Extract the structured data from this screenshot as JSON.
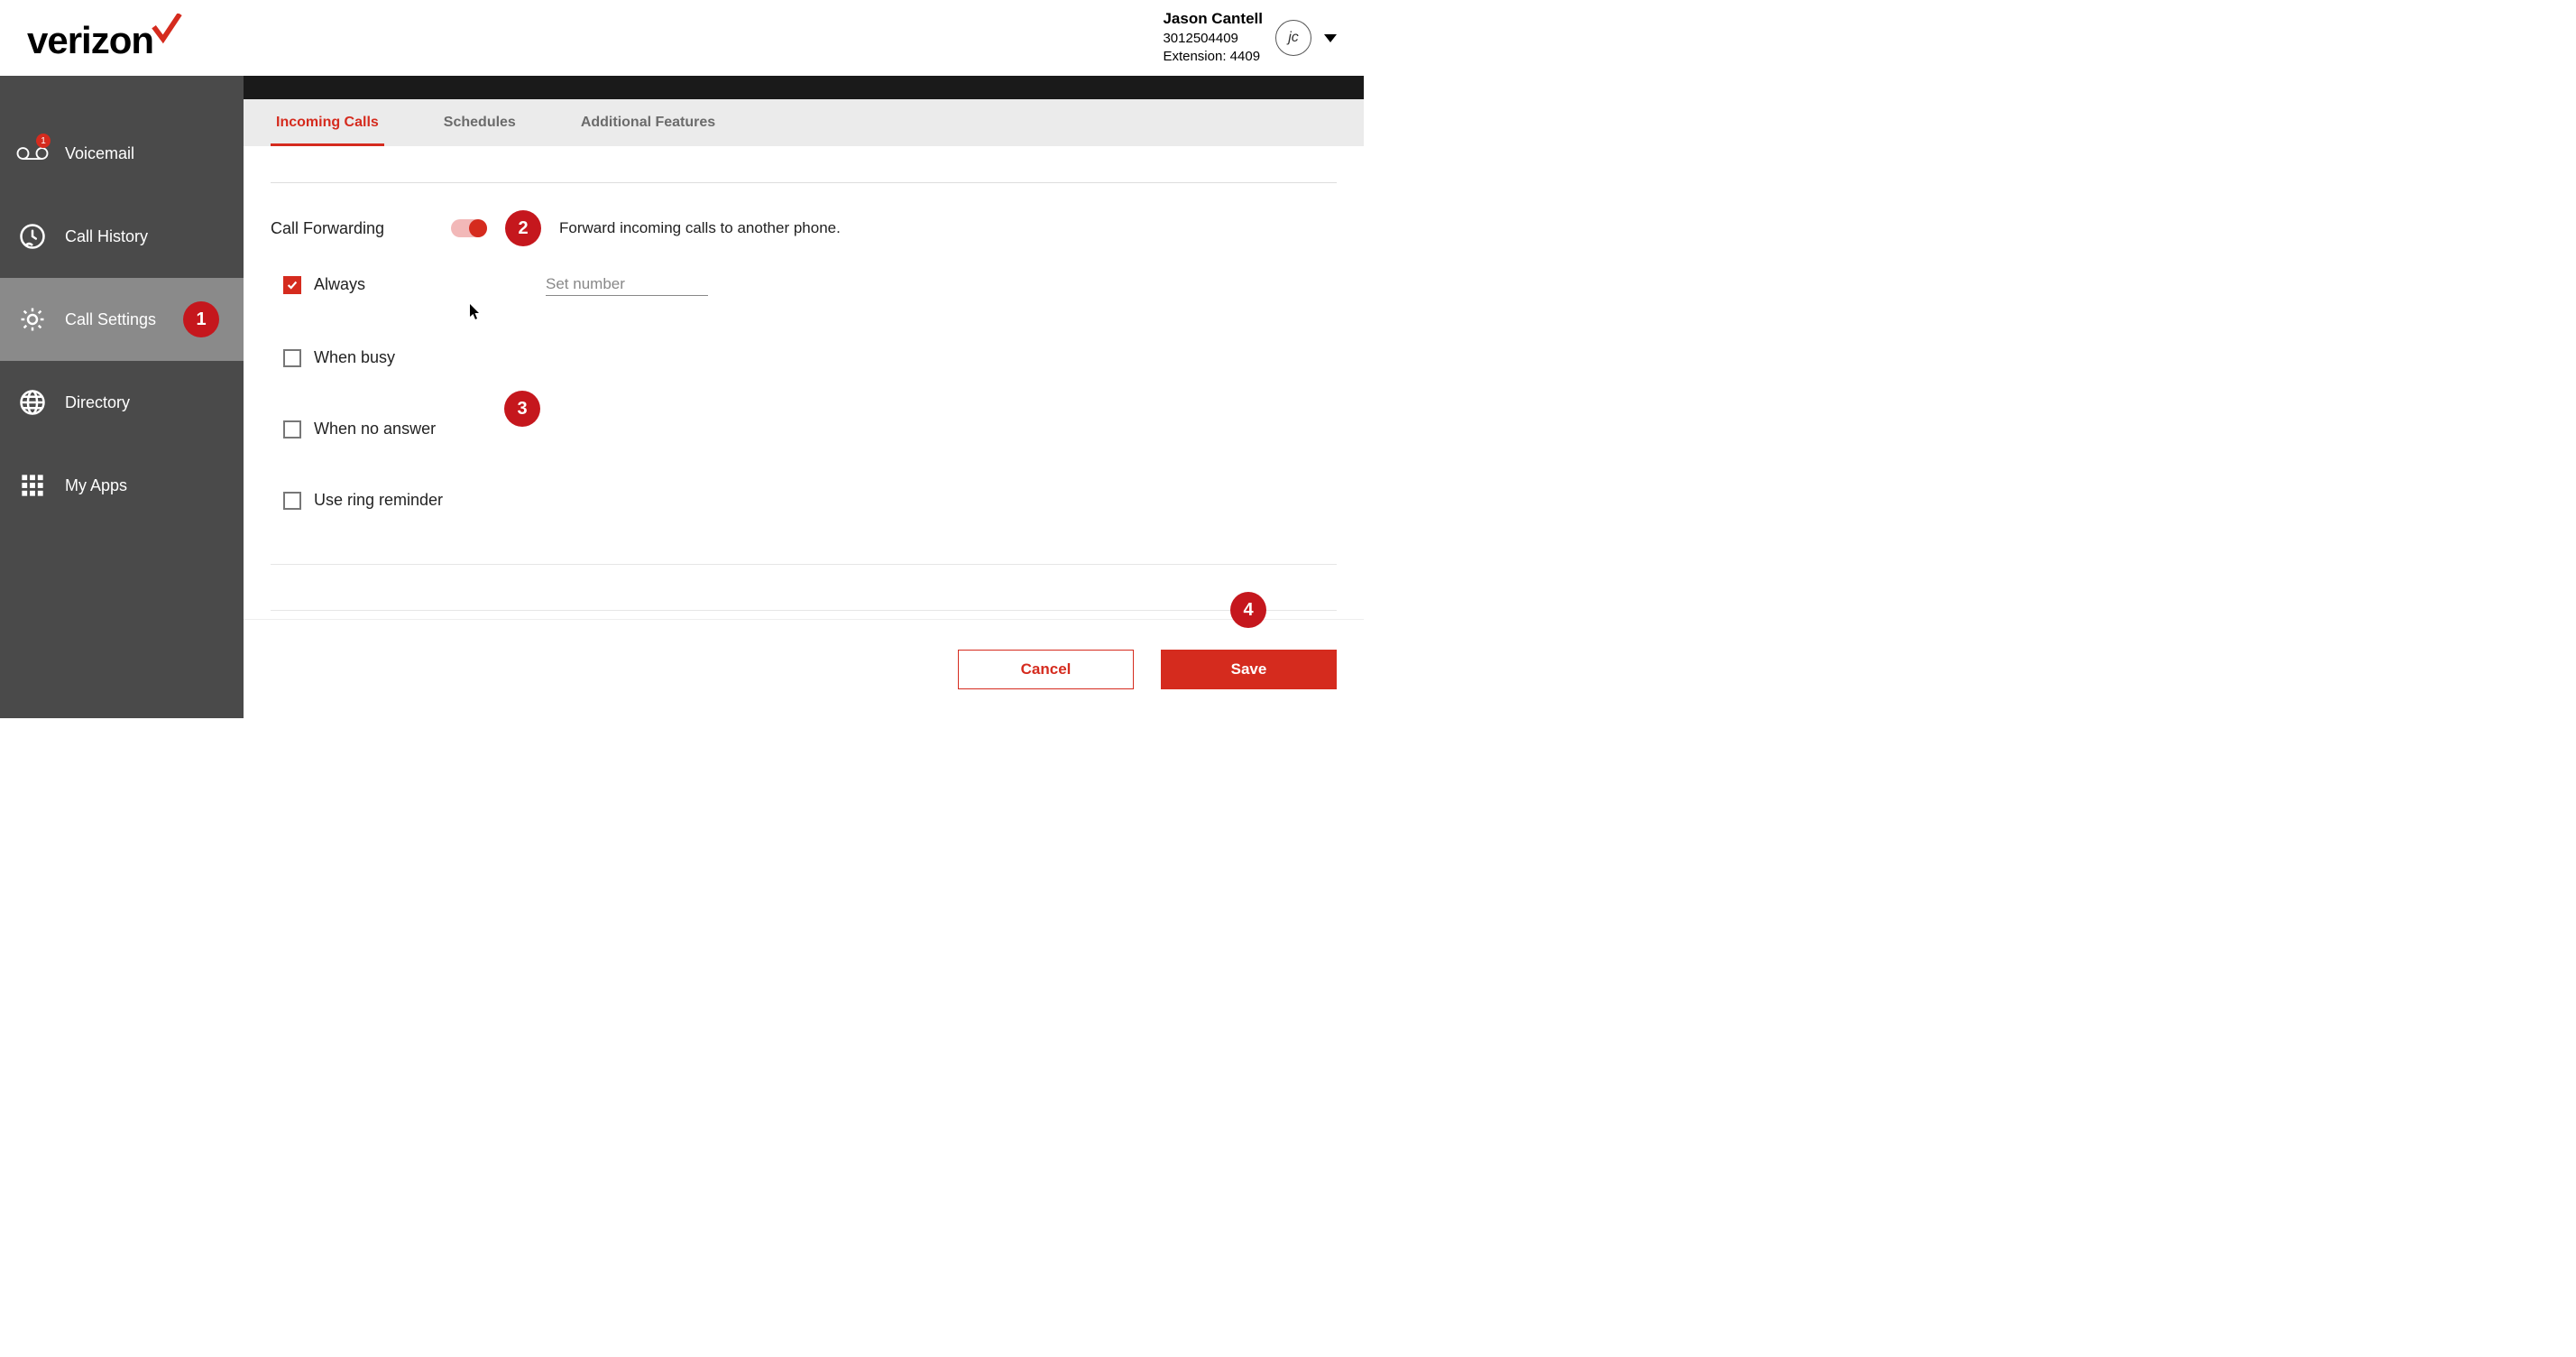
{
  "brand": {
    "name": "verizon"
  },
  "user": {
    "name": "Jason Cantell",
    "phone": "3012504409",
    "extension_label": "Extension: 4409",
    "initials": "jc"
  },
  "sidebar": {
    "items": [
      {
        "label": "Voicemail",
        "badge": "1"
      },
      {
        "label": "Call History"
      },
      {
        "label": "Call Settings"
      },
      {
        "label": "Directory"
      },
      {
        "label": "My Apps"
      }
    ],
    "active_index": 2
  },
  "tabs": {
    "items": [
      {
        "label": "Incoming Calls"
      },
      {
        "label": "Schedules"
      },
      {
        "label": "Additional Features"
      }
    ],
    "active_index": 0
  },
  "call_forwarding": {
    "title": "Call Forwarding",
    "enabled": true,
    "description": "Forward incoming calls to another phone.",
    "set_number_placeholder": "Set number",
    "options": [
      {
        "label": "Always",
        "checked": true
      },
      {
        "label": "When busy",
        "checked": false
      },
      {
        "label": "When no answer",
        "checked": false
      },
      {
        "label": "Use ring reminder",
        "checked": false
      }
    ]
  },
  "buttons": {
    "cancel": "Cancel",
    "save": "Save"
  },
  "callouts": {
    "c1": "1",
    "c2": "2",
    "c3": "3",
    "c4": "4"
  },
  "colors": {
    "accent": "#d52b1e"
  }
}
